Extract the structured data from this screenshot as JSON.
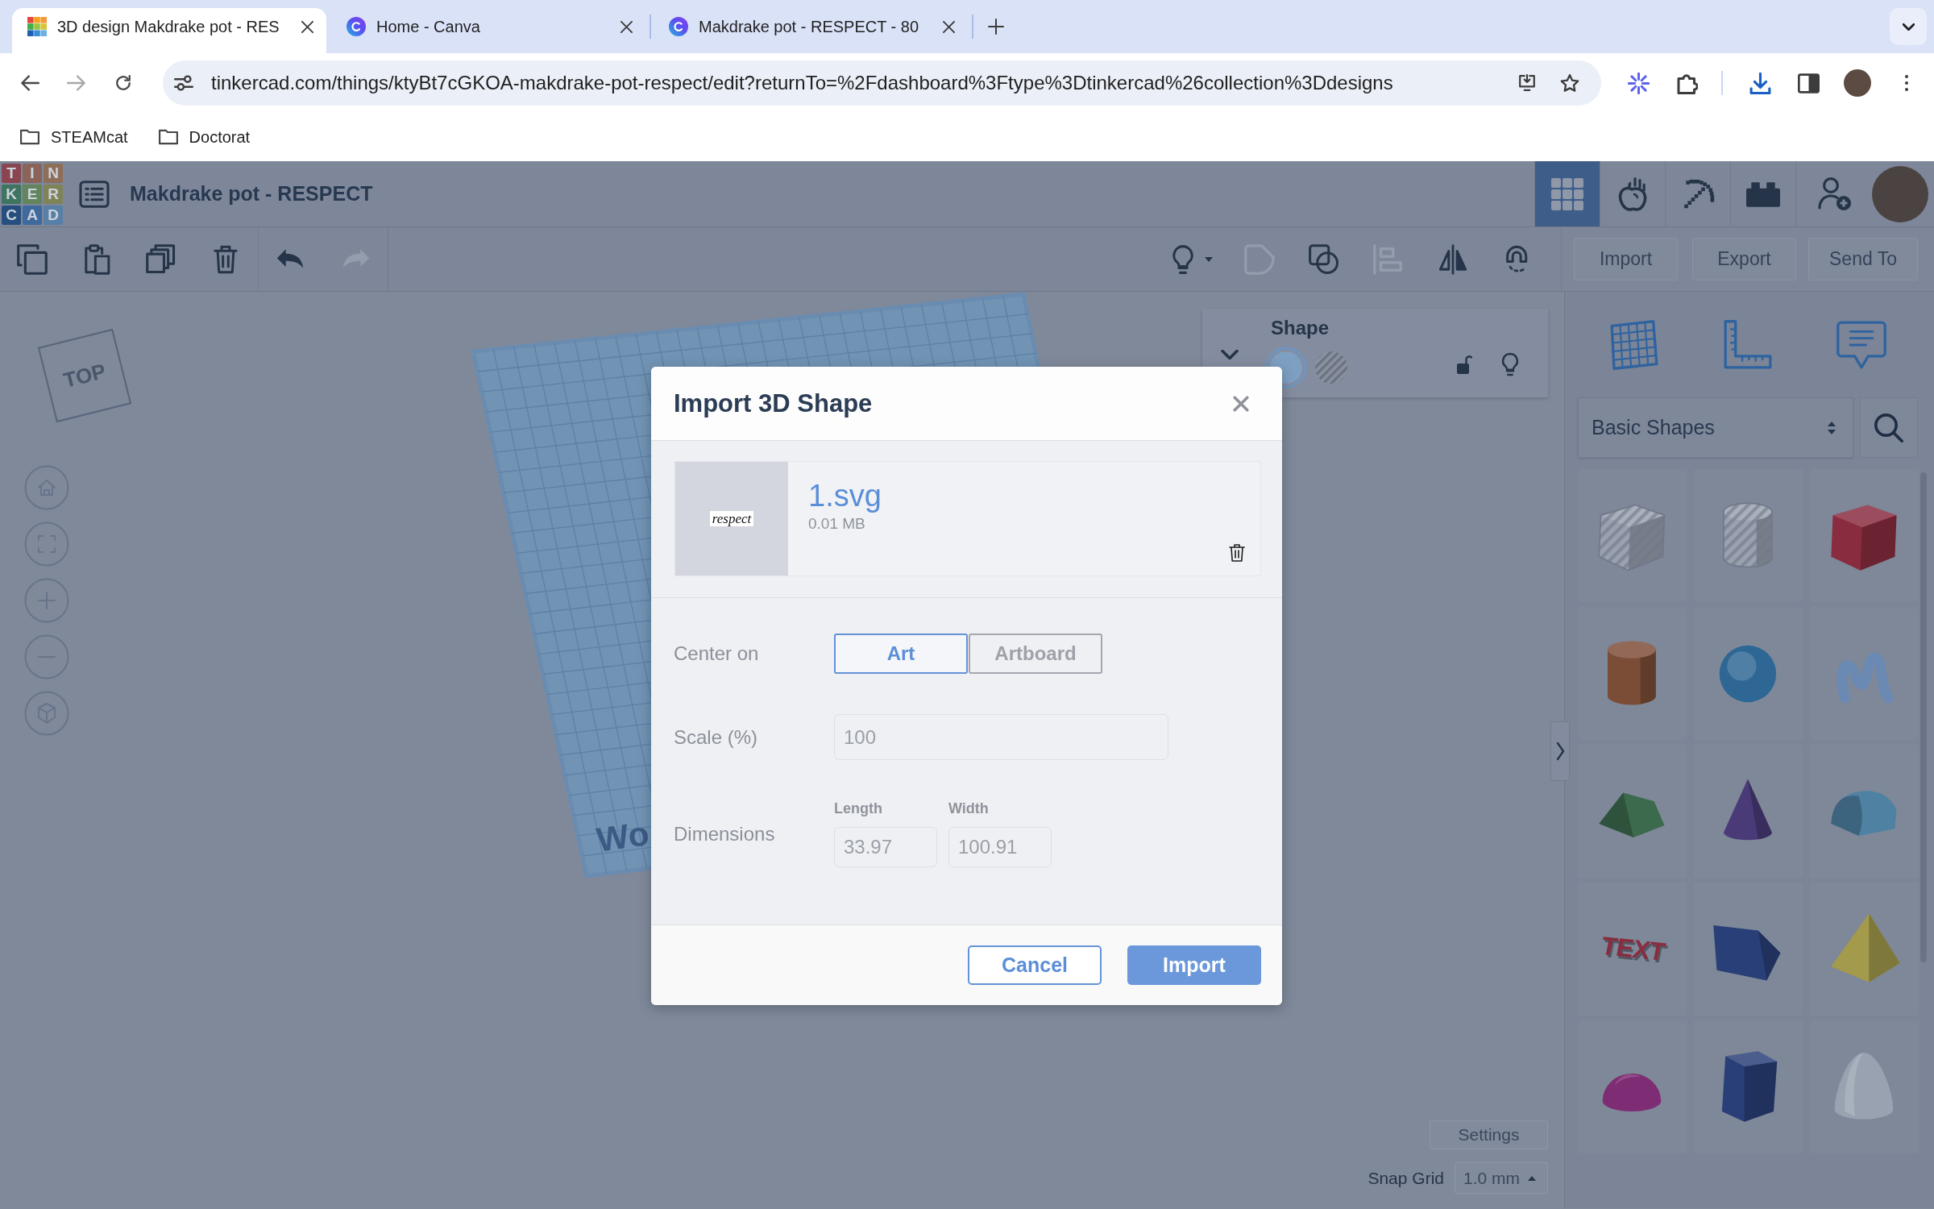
{
  "browser": {
    "tabs": [
      {
        "kind": "tiles",
        "title": "3D design Makdrake pot - RES",
        "selected": true
      },
      {
        "kind": "c-circle",
        "title": "Home - Canva",
        "selected": false
      },
      {
        "kind": "c-circle",
        "title": "Makdrake pot - RESPECT - 80",
        "selected": false
      }
    ],
    "nav": [
      {
        "kind": "back",
        "disabled": false
      },
      {
        "kind": "forward",
        "disabled": true
      },
      {
        "kind": "reload",
        "disabled": false
      }
    ],
    "url": "tinkercad.com/things/ktyBt7cGKOA-makdrake-pot-respect/edit?returnTo=%2Fdashboard%3Ftype%3Dtinkercad%26collection%3Ddesigns",
    "bookmarks": [
      {
        "label": "STEAMcat"
      },
      {
        "label": "Doctorat"
      }
    ]
  },
  "app": {
    "logo": [
      "T",
      "I",
      "N",
      "K",
      "E",
      "R",
      "C",
      "A",
      "D"
    ],
    "title": "Makdrake pot - RESPECT",
    "views": [
      {
        "kind": "grid",
        "selected": true
      },
      {
        "kind": "apple",
        "selected": false
      },
      {
        "kind": "pickaxe",
        "selected": false
      },
      {
        "kind": "brick",
        "selected": false
      }
    ]
  },
  "toolbar": {
    "tool_groups": [
      {
        "tools": [
          {
            "kind": "copy",
            "disabled": false
          },
          {
            "kind": "paste",
            "disabled": false
          },
          {
            "kind": "duplicate",
            "disabled": false
          },
          {
            "kind": "delete",
            "disabled": false
          }
        ]
      },
      {
        "tools": [
          {
            "kind": "undo",
            "disabled": false
          },
          {
            "kind": "redo",
            "disabled": true
          }
        ]
      }
    ],
    "view_tools": [
      {
        "kind": "bulb_menu",
        "disabled": false
      },
      {
        "kind": "group",
        "disabled": true
      },
      {
        "kind": "ungroup",
        "disabled": false
      },
      {
        "kind": "align",
        "disabled": true
      },
      {
        "kind": "mirror",
        "disabled": false
      },
      {
        "kind": "magnet",
        "disabled": false
      }
    ],
    "buttons": [
      "Import",
      "Export",
      "Send To"
    ]
  },
  "workspace": {
    "view_cube": "TOP",
    "workplane_label": "Wo",
    "shape_panel": {
      "title": "Shape",
      "options": [
        {
          "kind": "solid",
          "selected": true
        },
        {
          "kind": "hole",
          "selected": false
        }
      ]
    },
    "settings": "Settings",
    "snap_grid": {
      "label": "Snap Grid",
      "value": "1.0 mm"
    }
  },
  "library": {
    "category": "Basic Shapes",
    "shapes": [
      {
        "kind": "box",
        "hole": true,
        "color": "#9aa2b0"
      },
      {
        "kind": "cylinder",
        "hole": true,
        "color": "#9aa2b0"
      },
      {
        "kind": "box",
        "hole": false,
        "color": "#8a2c3f"
      },
      {
        "kind": "cylinder",
        "hole": false,
        "color": "#7c4d36"
      },
      {
        "kind": "sphere",
        "hole": false,
        "color": "#2e6794"
      },
      {
        "kind": "scribble",
        "hole": false,
        "color": "#6a8ab4"
      },
      {
        "kind": "roof",
        "hole": false,
        "color": "#3c6a4c"
      },
      {
        "kind": "cone",
        "hole": false,
        "color": "#4a3a78"
      },
      {
        "kind": "round_roof",
        "hole": false,
        "color": "#4e81a2"
      },
      {
        "kind": "text",
        "hole": false,
        "color": "#8a2c3f",
        "label": "TEXT"
      },
      {
        "kind": "wedge",
        "hole": false,
        "color": "#293f78"
      },
      {
        "kind": "pyramid",
        "hole": false,
        "color": "#a39a4c"
      },
      {
        "kind": "half_sphere",
        "hole": false,
        "color": "#7e2d74"
      },
      {
        "kind": "polygon",
        "hole": false,
        "color": "#293f78"
      },
      {
        "kind": "paraboloid",
        "hole": false,
        "color": "#98a2b0"
      }
    ]
  },
  "dialog": {
    "title": "Import 3D Shape",
    "file": {
      "preview_text": "respect",
      "name": "1.svg",
      "size": "0.01 MB"
    },
    "center_on": {
      "label": "Center on",
      "options": [
        {
          "label": "Art",
          "selected": true
        },
        {
          "label": "Artboard",
          "selected": false
        }
      ]
    },
    "scale": {
      "label": "Scale (%)",
      "value": "100"
    },
    "dimensions": {
      "label": "Dimensions",
      "fields": [
        {
          "label": "Length",
          "value": "33.97"
        },
        {
          "label": "Width",
          "value": "100.91"
        }
      ]
    },
    "buttons": [
      {
        "label": "Cancel",
        "kind": "secondary"
      },
      {
        "label": "Import",
        "kind": "primary"
      }
    ]
  }
}
